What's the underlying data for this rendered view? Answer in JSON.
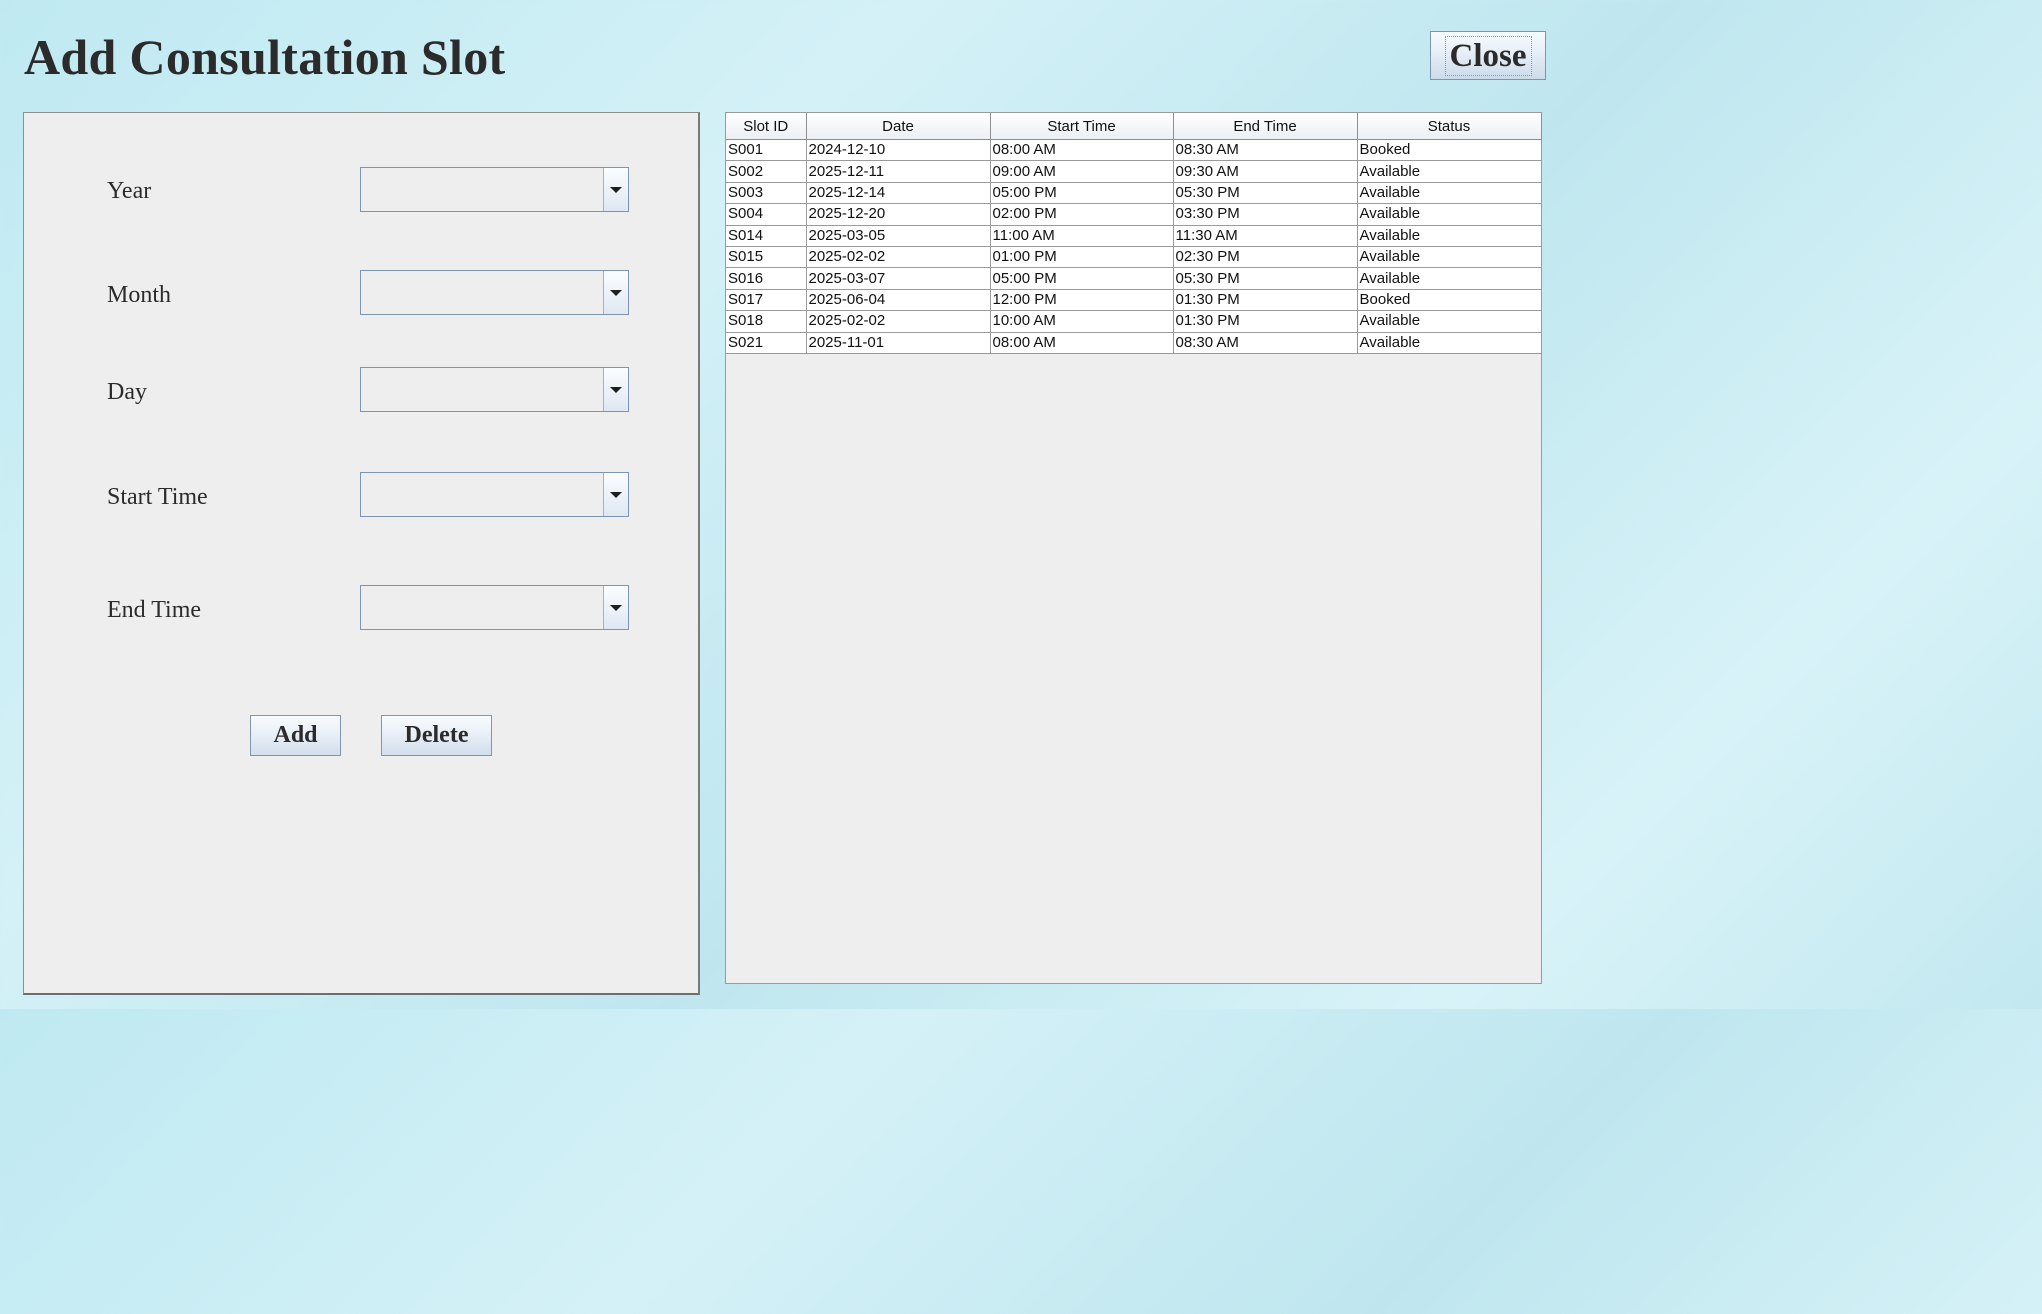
{
  "header": {
    "title": "Add Consultation Slot",
    "close_label": "Close"
  },
  "form": {
    "fields": [
      {
        "label": "Year",
        "value": ""
      },
      {
        "label": "Month",
        "value": ""
      },
      {
        "label": "Day",
        "value": ""
      },
      {
        "label": "Start Time",
        "value": ""
      },
      {
        "label": "End Time",
        "value": ""
      }
    ],
    "add_label": "Add",
    "delete_label": "Delete"
  },
  "table": {
    "columns": [
      "Slot ID",
      "Date",
      "Start Time",
      "End Time",
      "Status"
    ],
    "rows": [
      [
        "S001",
        "2024-12-10",
        "08:00 AM",
        "08:30 AM",
        "Booked"
      ],
      [
        "S002",
        "2025-12-11",
        "09:00 AM",
        "09:30 AM",
        "Available"
      ],
      [
        "S003",
        "2025-12-14",
        "05:00 PM",
        "05:30 PM",
        "Available"
      ],
      [
        "S004",
        "2025-12-20",
        "02:00 PM",
        "03:30 PM",
        "Available"
      ],
      [
        "S014",
        "2025-03-05",
        "11:00 AM",
        "11:30 AM",
        "Available"
      ],
      [
        "S015",
        "2025-02-02",
        "01:00 PM",
        "02:30 PM",
        "Available"
      ],
      [
        "S016",
        "2025-03-07",
        "05:00 PM",
        "05:30 PM",
        "Available"
      ],
      [
        "S017",
        "2025-06-04",
        "12:00 PM",
        "01:30 PM",
        "Booked"
      ],
      [
        "S018",
        "2025-02-02",
        "10:00 AM",
        "01:30 PM",
        "Available"
      ],
      [
        "S021",
        "2025-11-01",
        "08:00 AM",
        "08:30 AM",
        "Available"
      ]
    ]
  },
  "icons": {
    "dropdown": "chevron-down-icon"
  }
}
